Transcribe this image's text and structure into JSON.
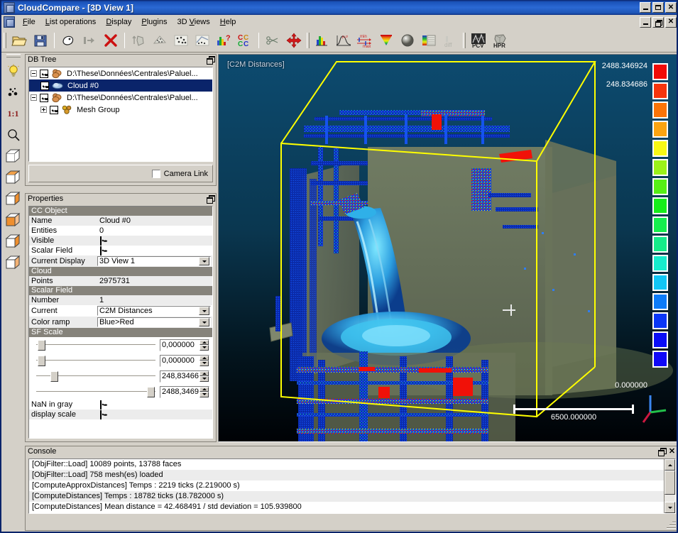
{
  "window": {
    "title": "CloudCompare - [3D View 1]",
    "app_icon": "app-icon",
    "minimize": "_",
    "maximize": "□",
    "restore": "❐",
    "close": "×"
  },
  "menubar": {
    "items": [
      {
        "label": "File",
        "mnemonic": "F"
      },
      {
        "label": "List operations",
        "mnemonic": "L"
      },
      {
        "label": "Display",
        "mnemonic": "D"
      },
      {
        "label": "Plugins",
        "mnemonic": "P"
      },
      {
        "label": "3D Views",
        "mnemonic": "V"
      },
      {
        "label": "Help",
        "mnemonic": "H"
      }
    ]
  },
  "toolbar": {
    "buttons": [
      {
        "name": "open-icon",
        "tip": "Open"
      },
      {
        "name": "save-icon",
        "tip": "Save"
      },
      {
        "name": "clone-icon",
        "tip": "Clone"
      },
      {
        "name": "merge-icon",
        "tip": "Merge"
      },
      {
        "name": "delete-icon",
        "tip": "Delete"
      },
      {
        "name": "sample-mesh-icon",
        "tip": "Sample points on mesh"
      },
      {
        "name": "mesh-delaunay-icon",
        "tip": "Delaunay mesh"
      },
      {
        "name": "subsample-icon",
        "tip": "Subsample"
      },
      {
        "name": "segment-icon",
        "tip": "Segment"
      },
      {
        "name": "stats-test-icon",
        "tip": "Statistical test"
      },
      {
        "name": "cc-compare-icon",
        "tip": "Cloud/Cloud distance"
      },
      {
        "name": "scissors-icon",
        "tip": "Cut"
      },
      {
        "name": "translate-rotate-icon",
        "tip": "Translate / Rotate"
      },
      {
        "name": "histogram-icon",
        "tip": "Compute histogram"
      },
      {
        "name": "gaussian-icon",
        "tip": "Gaussian filter"
      },
      {
        "name": "minmax-icon",
        "tip": "Filter by value (min/max)"
      },
      {
        "name": "color-ramp-icon",
        "tip": "Color ramp"
      },
      {
        "name": "sphere-icon",
        "tip": "Fit sphere"
      },
      {
        "name": "scalar-field-icon",
        "tip": "Scalar field tools"
      },
      {
        "name": "sfdiff-icon",
        "tip": "SF difference"
      },
      {
        "name": "pcv-icon",
        "tip": "PCV (ShadeVis)"
      },
      {
        "name": "hpr-icon",
        "tip": "HPR (Hidden Point Removal)"
      }
    ]
  },
  "left_toolbar": {
    "buttons": [
      {
        "name": "light-bulb-icon",
        "tip": "Toggle light"
      },
      {
        "name": "point-picking-icon",
        "tip": "Point picking"
      },
      {
        "name": "zoom-1-1-icon",
        "label": "1:1",
        "tip": "Zoom 1:1"
      },
      {
        "name": "magnifier-icon",
        "tip": "Zoom / global view"
      },
      {
        "name": "view-front-icon",
        "tip": "Front view"
      },
      {
        "name": "view-back-icon",
        "tip": "Back view"
      },
      {
        "name": "view-left-icon",
        "tip": "Left view"
      },
      {
        "name": "view-right-icon",
        "tip": "Right view"
      },
      {
        "name": "view-top-icon",
        "tip": "Top view"
      },
      {
        "name": "view-bottom-icon",
        "tip": "Bottom view"
      }
    ]
  },
  "db_tree": {
    "title": "DB Tree",
    "items": [
      {
        "label": "D:\\These\\Données\\Centrales\\Paluel...",
        "icon": "cloud-group-icon",
        "depth": 0,
        "expander": "minus",
        "checked": true,
        "selected": false
      },
      {
        "label": "Cloud #0",
        "icon": "cloud-icon",
        "depth": 1,
        "expander": "none",
        "checked": true,
        "selected": true
      },
      {
        "label": "D:\\These\\Données\\Centrales\\Paluel...",
        "icon": "cloud-group-icon",
        "depth": 0,
        "expander": "minus",
        "checked": true,
        "selected": false
      },
      {
        "label": "Mesh Group",
        "icon": "mesh-group-icon",
        "depth": 1,
        "expander": "plus",
        "checked": true,
        "selected": false
      }
    ],
    "camera_link_label": "Camera Link",
    "camera_link_checked": false
  },
  "properties": {
    "title": "Properties",
    "sections": [
      {
        "header": "CC Object",
        "rows": [
          {
            "key": "Name",
            "value": "Cloud #0",
            "type": "text"
          },
          {
            "key": "Entities",
            "value": "0",
            "type": "text"
          },
          {
            "key": "Visible",
            "value": "",
            "type": "checkbox",
            "checked": true
          },
          {
            "key": "Scalar Field",
            "value": "",
            "type": "checkbox",
            "checked": true
          },
          {
            "key": "Current Display",
            "value": "3D View 1",
            "type": "combo"
          }
        ]
      },
      {
        "header": "Cloud",
        "rows": [
          {
            "key": "Points",
            "value": "2975731",
            "type": "text"
          }
        ]
      },
      {
        "header": "Scalar Field",
        "rows": [
          {
            "key": "Number",
            "value": "1",
            "type": "text"
          },
          {
            "key": "Current",
            "value": "C2M Distances",
            "type": "combo"
          },
          {
            "key": "Color ramp",
            "value": "Blue>Red",
            "type": "combo"
          }
        ]
      }
    ],
    "sf_scale": {
      "header": "SF Scale",
      "sliders": [
        {
          "name": "sf-min-displayed-slider",
          "value": "0,000000",
          "pos_pct": 1
        },
        {
          "name": "sf-min-saturation-slider",
          "value": "0,000000",
          "pos_pct": 1
        },
        {
          "name": "sf-max-saturation-slider",
          "value": "248,83466",
          "pos_pct": 12
        },
        {
          "name": "sf-max-displayed-slider",
          "value": "2488,3469",
          "pos_pct": 93
        }
      ],
      "options": [
        {
          "label": "NaN in gray",
          "checked": true
        },
        {
          "label": "display scale",
          "checked": true
        }
      ]
    }
  },
  "view3d": {
    "sf_label": "[C2M Distances]",
    "color_scale": {
      "top_label": "2488.346924",
      "second_label": "248.834686",
      "bottom_label": "0.000000",
      "swatches": [
        "#f10b07",
        "#f5340d",
        "#fb7408",
        "#fba411",
        "#f8f815",
        "#9bf219",
        "#56ef15",
        "#16ee1b",
        "#15ef4e",
        "#15eb8a",
        "#16eccd",
        "#12c6f5",
        "#0d7bf8",
        "#0a37f8",
        "#0a0df6",
        "#1008f7"
      ]
    },
    "scale_bar_value": "6500.000000",
    "axis_triad": {
      "x": "#c01030",
      "y": "#20c040",
      "z": "#3070e8"
    },
    "background_top": "#0d4a6e",
    "background_bottom": "#000204",
    "bbox_color": "#ffff00"
  },
  "console": {
    "title": "Console",
    "lines": [
      "[ObjFilter::Load] 10089 points, 13788 faces",
      "[ObjFilter::Load] 758 mesh(es) loaded",
      "[ComputeApproxDistances] Temps : 2219 ticks (2.219000 s)",
      "[ComputeDistances] Temps : 18782 ticks (18.782000 s)",
      "[ComputeDistances] Mean distance = 42.468491 / std deviation = 105.939800"
    ]
  }
}
